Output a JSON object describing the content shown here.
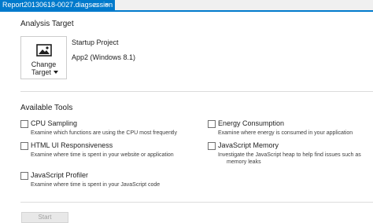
{
  "tab": {
    "title": "Report20130618-0027.diagsession",
    "pin_glyph": "⌂",
    "close_glyph": "×"
  },
  "analysis_target": {
    "heading": "Analysis Target",
    "change_target_line1": "Change",
    "change_target_line2": "Target",
    "change_target_icon": "target-image-icon",
    "startup_project_label": "Startup Project",
    "startup_project_value": "App2 (Windows 8.1)"
  },
  "available_tools": {
    "heading": "Available Tools",
    "tools": [
      {
        "name": "CPU Sampling",
        "description": "Examine which functions are using the CPU most frequently",
        "checked": false
      },
      {
        "name": "Energy Consumption",
        "description": "Examine where energy is consumed in your application",
        "checked": false
      },
      {
        "name": "HTML UI Responsiveness",
        "description": "Examine where time is spent in your website or application",
        "checked": false
      },
      {
        "name": "JavaScript Memory",
        "description": "Investigate the JavaScript heap to help find issues such as",
        "description2": "memory leaks",
        "checked": false
      },
      {
        "name": "JavaScript Profiler",
        "description": "Examine where time is spent in your JavaScript code",
        "checked": false
      }
    ]
  },
  "start_button": {
    "label": "Start",
    "enabled": false
  },
  "colors": {
    "accent": "#007acc",
    "separator": "#dcdcdc",
    "disabled_text": "#a0a0a0"
  }
}
